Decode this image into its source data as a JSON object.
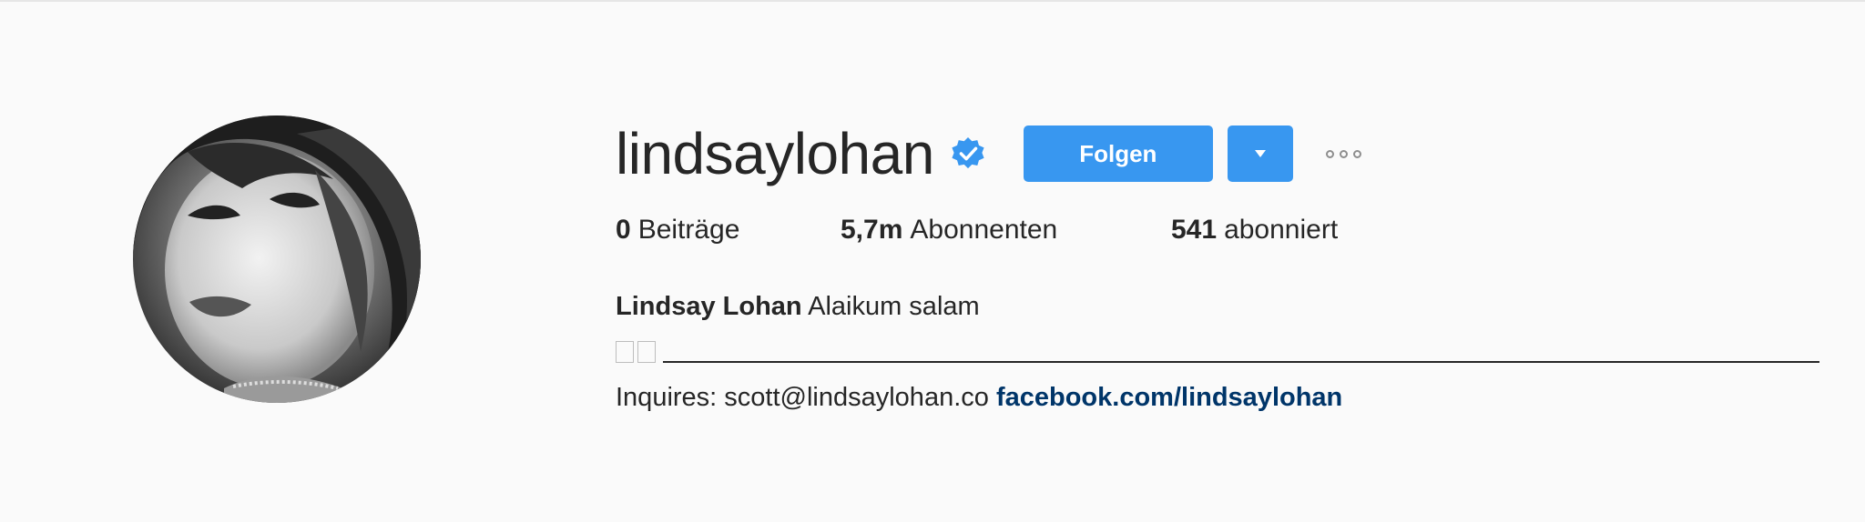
{
  "profile": {
    "username": "lindsaylohan",
    "verified": true,
    "follow_label": "Folgen",
    "accent_color": "#3897f0",
    "stats": {
      "posts_count": "0",
      "posts_label": "Beiträge",
      "followers_count": "5,7m",
      "followers_label": "Abonnenten",
      "following_count": "541",
      "following_label": "abonniert"
    },
    "bio": {
      "full_name": "Lindsay Lohan",
      "text": "Alaikum salam",
      "inquiries_text": "Inquires: scott@lindsaylohan.co",
      "link_text": "facebook.com/lindsaylohan",
      "link_color": "#003569"
    }
  },
  "icons": [
    "verified-badge-icon",
    "chevron-down-icon",
    "more-options-icon"
  ]
}
